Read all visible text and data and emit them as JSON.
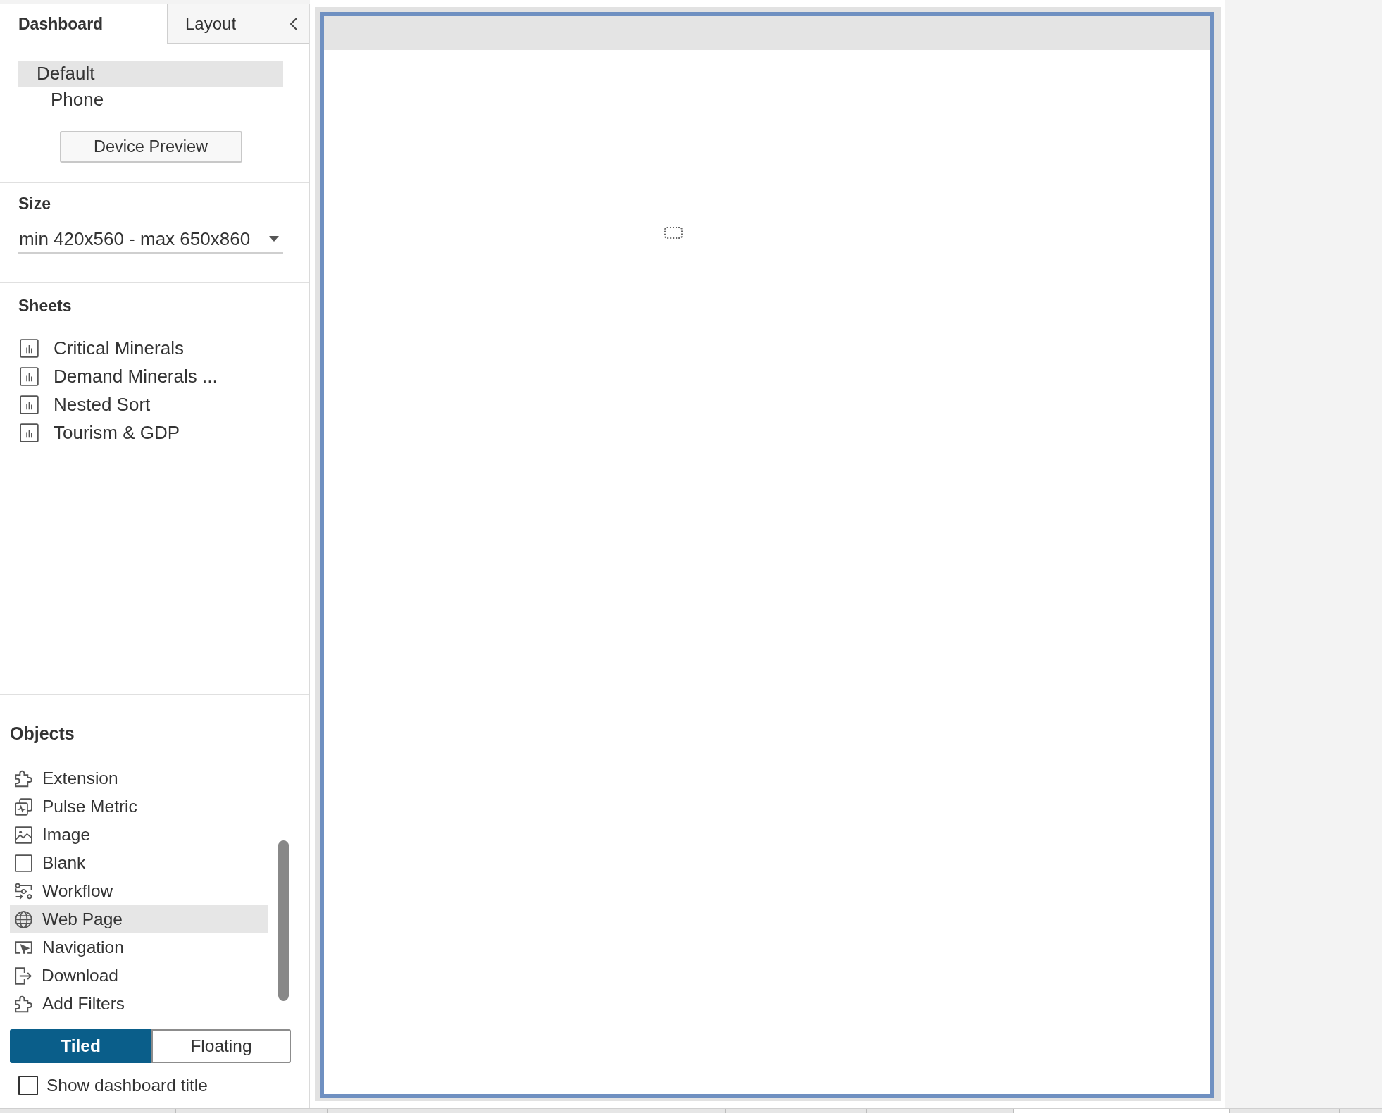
{
  "sidebar": {
    "tabs": [
      {
        "label": "Dashboard",
        "selected": true
      },
      {
        "label": "Layout",
        "selected": false
      }
    ],
    "device_layouts": [
      {
        "label": "Default",
        "selected": true,
        "children": [
          {
            "label": "Phone",
            "selected": false
          }
        ]
      }
    ],
    "device_preview_button": "Device Preview",
    "size": {
      "title": "Size",
      "value": "min 420x560 - max 650x860"
    },
    "sheets": {
      "title": "Sheets",
      "items": [
        "Critical Minerals",
        "Demand Minerals ...",
        "Nested Sort",
        "Tourism & GDP"
      ]
    },
    "objects": {
      "title": "Objects",
      "items": [
        {
          "label": "Extension",
          "kind": "extension",
          "selected": false
        },
        {
          "label": "Pulse Metric",
          "kind": "pulse",
          "selected": false
        },
        {
          "label": "Image",
          "kind": "image",
          "selected": false
        },
        {
          "label": "Blank",
          "kind": "blank",
          "selected": false
        },
        {
          "label": "Workflow",
          "kind": "workflow",
          "selected": false
        },
        {
          "label": "Web Page",
          "kind": "web",
          "selected": true
        },
        {
          "label": "Navigation",
          "kind": "navigation",
          "selected": false
        },
        {
          "label": "Download",
          "kind": "download",
          "selected": false
        },
        {
          "label": "Add Filters",
          "kind": "filters",
          "selected": false
        }
      ]
    },
    "layout_mode": [
      {
        "label": "Tiled",
        "selected": true
      },
      {
        "label": "Floating",
        "selected": false
      }
    ],
    "show_title": {
      "label": "Show dashboard title",
      "checked": false
    }
  },
  "bottom_tabs": [
    {
      "selected": false
    },
    {
      "selected": false
    },
    {
      "selected": false
    },
    {
      "selected": false
    },
    {
      "selected": false
    },
    {
      "selected": false
    },
    {
      "selected": true
    },
    {
      "selected": false
    },
    {
      "selected": false
    }
  ]
}
